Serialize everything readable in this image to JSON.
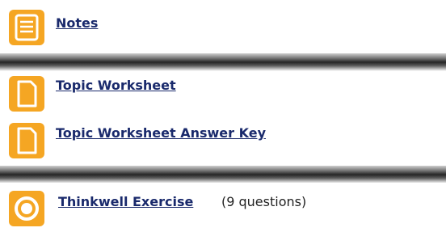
{
  "notes": {
    "icon": "notes-icon",
    "label": "Notes"
  },
  "worksheets": [
    {
      "icon": "document-icon",
      "label": "Topic Worksheet"
    },
    {
      "icon": "document-icon",
      "label": "Topic Worksheet Answer Key"
    }
  ],
  "exercise": {
    "icon": "exercise-icon",
    "label": "Thinkwell Exercise",
    "meta": "(9 questions)"
  },
  "colors": {
    "icon_orange": "#f5a623",
    "link_navy": "#1a2a6c"
  }
}
